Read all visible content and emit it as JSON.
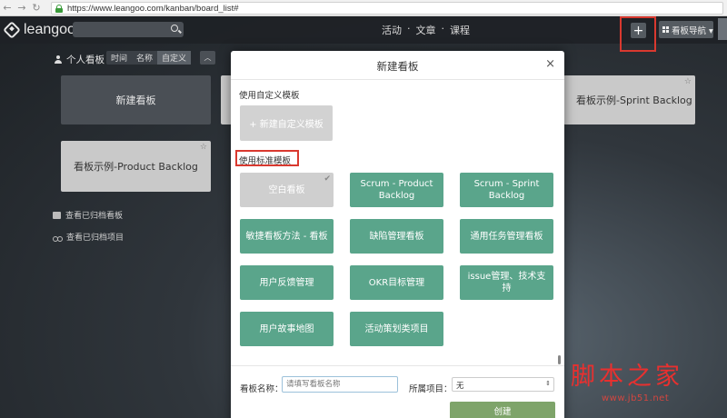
{
  "browser": {
    "url": "https://www.leangoo.com/kanban/board_list#"
  },
  "topnav": {
    "brand": "leangoo",
    "links": [
      "活动",
      "·",
      "文章",
      "·",
      "课程"
    ],
    "add_label": "+",
    "board_nav_label": "看板导航 ▾"
  },
  "boards_panel": {
    "personal_title": "个人看板",
    "sort": [
      "时间",
      "名称",
      "自定义"
    ],
    "toggle_label": "︿",
    "new_board_label": "新建看板",
    "sprint_backlog_label": "看板示例-Sprint Backlog",
    "product_backlog_label": "看板示例-Product Backlog",
    "archived_boards_label": "查看已归档看板",
    "archived_projects_label": "查看已归档项目"
  },
  "modal": {
    "title": "新建看板",
    "close_label": "×",
    "custom_section_label": "使用自定义模板",
    "new_custom_template_label": "+ 新建自定义模板",
    "standard_section_label": "使用标准模板",
    "templates": [
      "空白看板",
      "Scrum - Product Backlog",
      "Scrum - Sprint Backlog",
      "敏捷看板方法 - 看板",
      "缺陷管理看板",
      "通用任务管理看板",
      "用户反馈管理",
      "OKR目标管理",
      "issue管理、技术支持",
      "用户故事地图",
      "活动策划类项目"
    ],
    "board_name_label": "看板名称：",
    "board_name_placeholder": "请填写看板名称",
    "project_label": "所属项目：",
    "project_value": "无",
    "create_label": "创建"
  },
  "watermark": {
    "title": "脚本之家",
    "site": "www.jb51.net"
  }
}
